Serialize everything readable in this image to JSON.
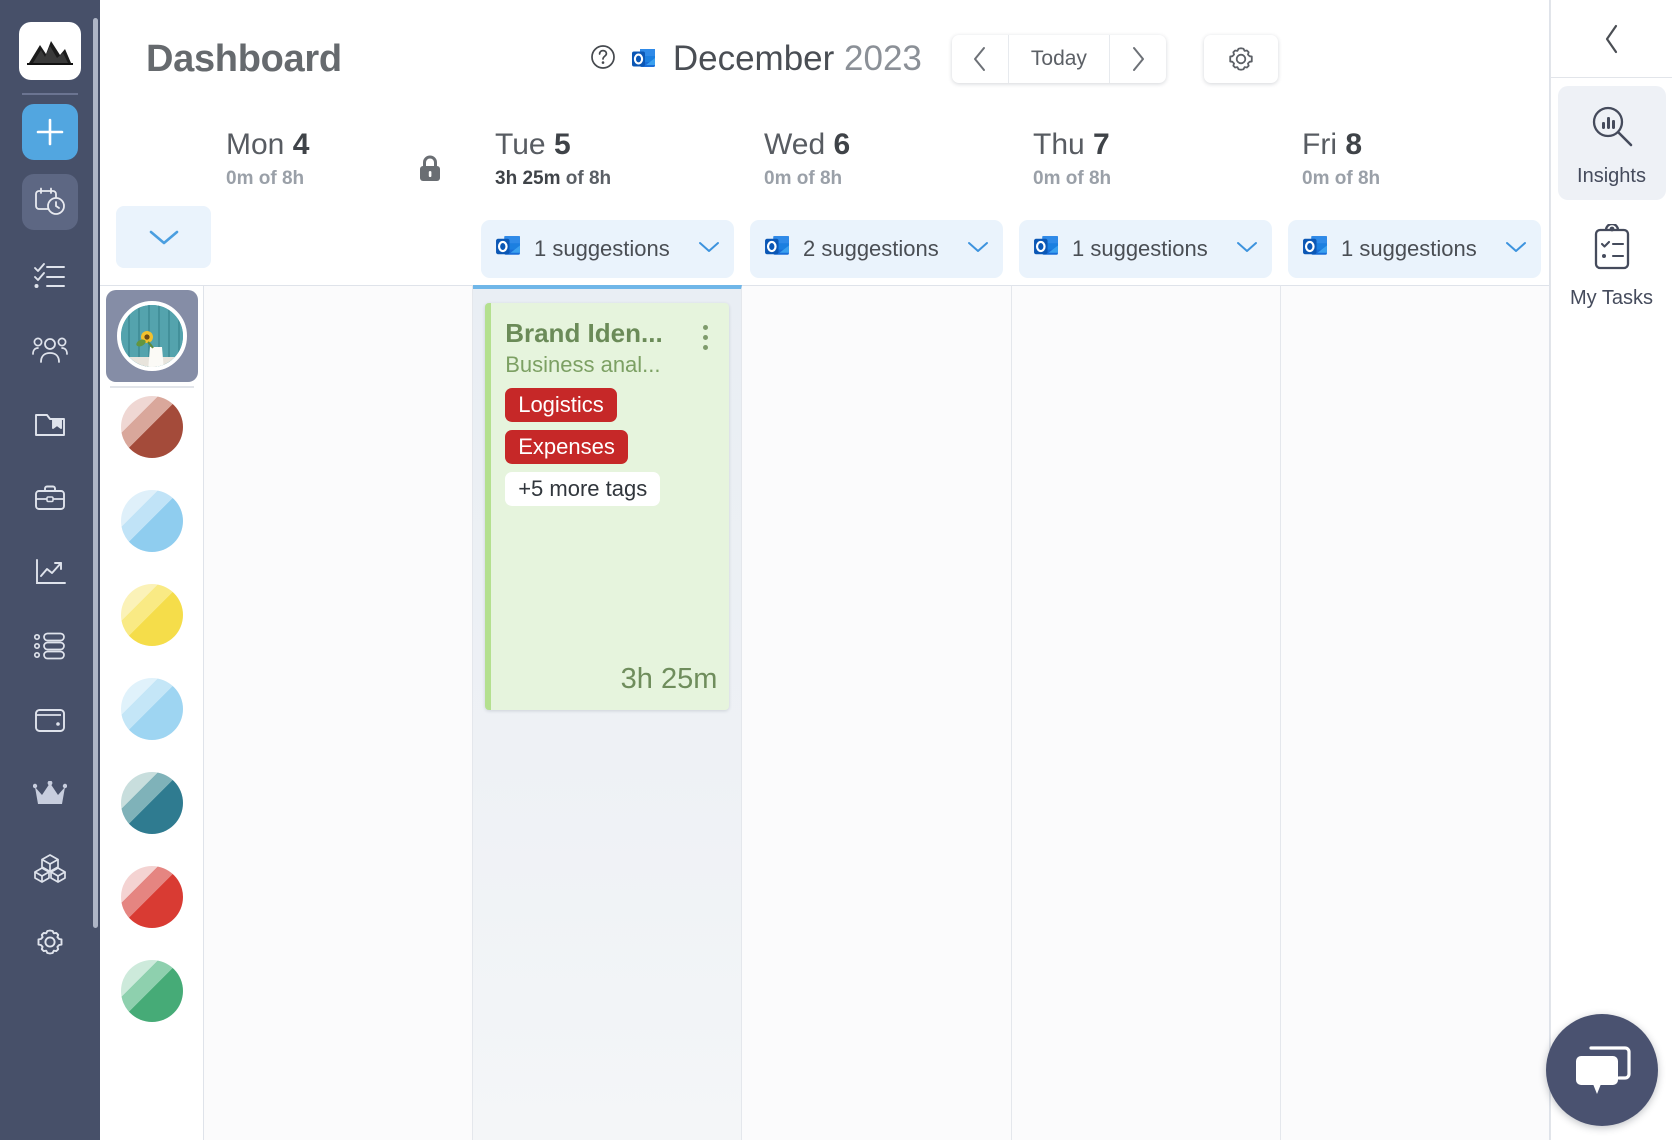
{
  "app": {
    "page_title": "Dashboard",
    "logo_icon": "mountain-logo"
  },
  "rail": {
    "items": [
      {
        "icon": "plus-icon",
        "name": "add-button"
      },
      {
        "icon": "calendar-clock-icon",
        "name": "timesheet"
      },
      {
        "icon": "checklist-icon",
        "name": "tasks"
      },
      {
        "icon": "people-icon",
        "name": "team"
      },
      {
        "icon": "folder-bookmark-icon",
        "name": "projects"
      },
      {
        "icon": "briefcase-icon",
        "name": "clients"
      },
      {
        "icon": "trend-chart-icon",
        "name": "reports"
      },
      {
        "icon": "list-settings-icon",
        "name": "activities"
      },
      {
        "icon": "wallet-icon",
        "name": "billing"
      },
      {
        "icon": "crown-icon",
        "name": "premium"
      },
      {
        "icon": "cubes-icon",
        "name": "integrations"
      },
      {
        "icon": "gear-icon",
        "name": "settings"
      }
    ]
  },
  "header": {
    "help_icon": "question-circle-icon",
    "outlook_icon": "outlook-icon",
    "month": "December",
    "year": "2023",
    "prev_label": "prev-icon",
    "today_label": "Today",
    "next_label": "next-icon",
    "settings_icon": "gear-icon"
  },
  "calendar": {
    "collapse_icon": "chevron-down-icon",
    "days": [
      {
        "name": "Mon",
        "num": "4",
        "logged": "0m",
        "of": "of 8h",
        "locked": true,
        "today": false,
        "suggestions": null
      },
      {
        "name": "Tue",
        "num": "5",
        "logged": "3h 25m",
        "of": "of 8h",
        "locked": false,
        "today": true,
        "suggestions": "1 suggestions"
      },
      {
        "name": "Wed",
        "num": "6",
        "logged": "0m",
        "of": "of 8h",
        "locked": false,
        "today": false,
        "suggestions": "2 suggestions"
      },
      {
        "name": "Thu",
        "num": "7",
        "logged": "0m",
        "of": "of 8h",
        "locked": false,
        "today": false,
        "suggestions": "1 suggestions"
      },
      {
        "name": "Fri",
        "num": "8",
        "logged": "0m",
        "of": "of 8h",
        "locked": false,
        "today": false,
        "suggestions": "1 suggestions"
      }
    ],
    "entry": {
      "title": "Brand Iden...",
      "subtitle": "Business anal...",
      "tags": [
        "Logistics",
        "Expenses"
      ],
      "more_tags": "+5 more tags",
      "duration_h": "3h",
      "duration_m": "25m",
      "tag_color": "#c62828",
      "card_bg": "#e6f4dd",
      "card_accent": "#b4e08f"
    },
    "avatars": [
      {
        "selected": true,
        "name": "avatar-photo"
      },
      {
        "selected": false,
        "c1": "#a44b3a",
        "c2": "#efd7d3"
      },
      {
        "selected": false,
        "c1": "#8fcdef",
        "c2": "#dff0fa"
      },
      {
        "selected": false,
        "c1": "#f5dd4a",
        "c2": "#fbf2b8"
      },
      {
        "selected": false,
        "c1": "#9ed5f2",
        "c2": "#e0f2fb"
      },
      {
        "selected": false,
        "c1": "#2f7b90",
        "c2": "#c8dedd"
      },
      {
        "selected": false,
        "c1": "#d93b33",
        "c2": "#f4d3d2"
      },
      {
        "selected": false,
        "c1": "#46ab77",
        "c2": "#cdeadb"
      }
    ]
  },
  "right_panel": {
    "collapse_icon": "chevron-left-icon",
    "items": [
      {
        "label": "Insights",
        "icon": "insights-magnifier-icon",
        "active": true
      },
      {
        "label": "My Tasks",
        "icon": "clipboard-checklist-icon",
        "active": false
      }
    ],
    "chat_icon": "chat-bubbles-icon"
  }
}
